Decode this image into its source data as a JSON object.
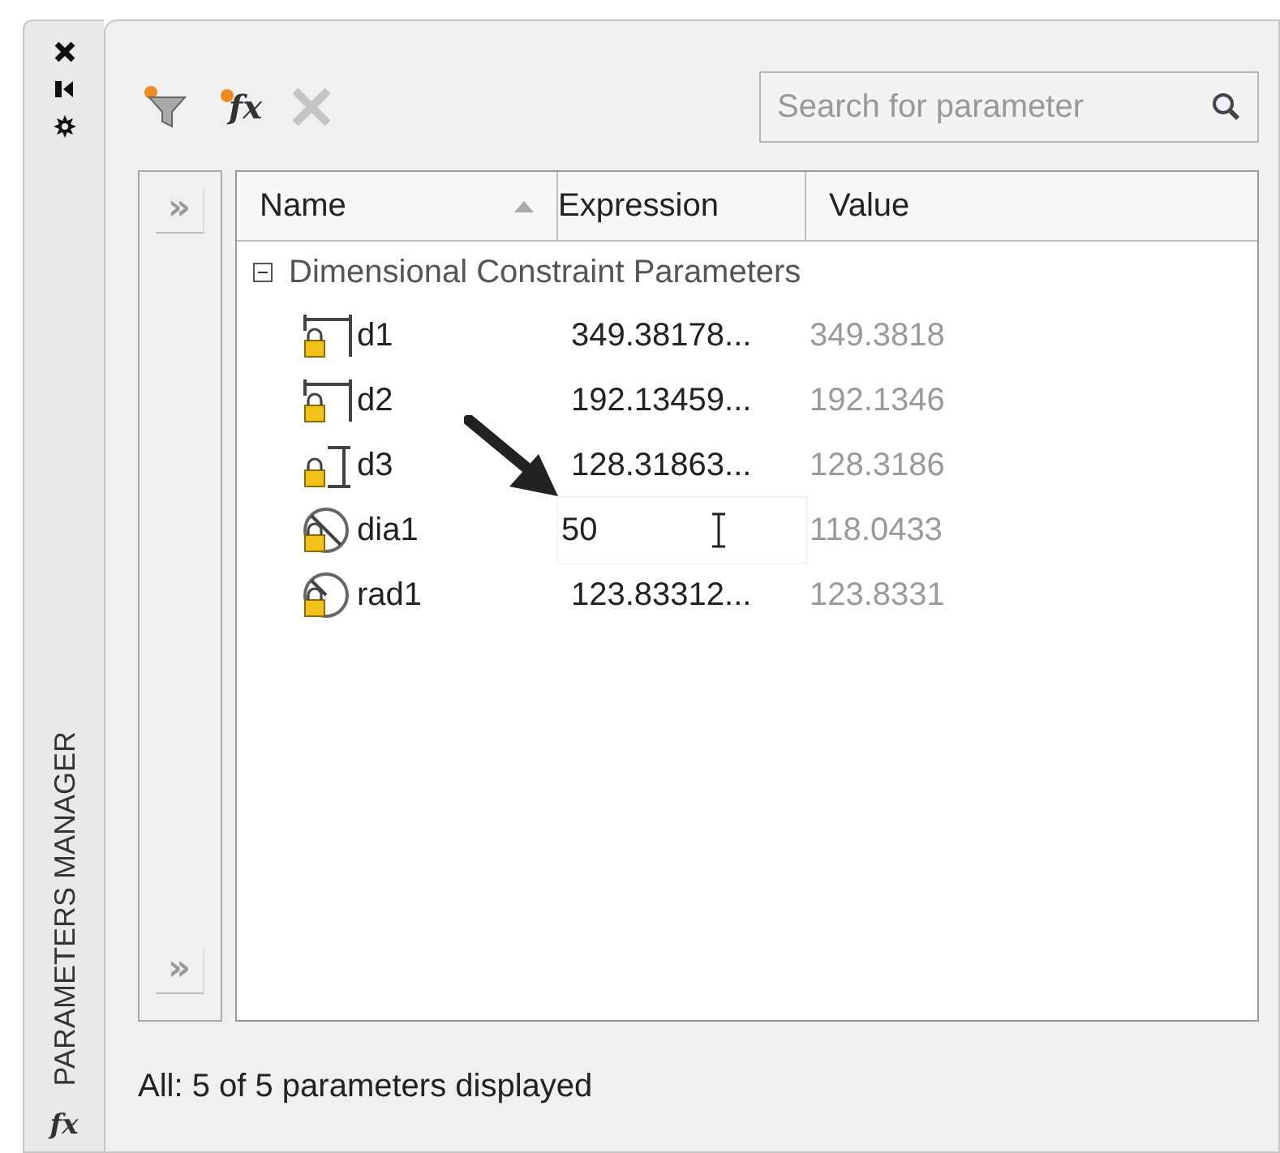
{
  "palette": {
    "title": "PARAMETERS MANAGER",
    "title_icon": "fx"
  },
  "toolbar": {
    "function_label": "fx",
    "delete_disabled": true
  },
  "search": {
    "placeholder": "Search for parameter"
  },
  "filter_pane": {
    "buttons": [
      "»",
      "»"
    ]
  },
  "table": {
    "columns": [
      {
        "label": "Name",
        "sorted": true
      },
      {
        "label": "Expression",
        "sorted": false
      },
      {
        "label": "Value",
        "sorted": false
      }
    ],
    "groups": [
      {
        "label": "Dimensional Constraint Parameters",
        "expanded": true,
        "rows": [
          {
            "kind": "horizontal",
            "name": "d1",
            "expression": "349.38178...",
            "value": "349.3818",
            "editing": false
          },
          {
            "kind": "horizontal",
            "name": "d2",
            "expression": "192.13459...",
            "value": "192.1346",
            "editing": false
          },
          {
            "kind": "vertical",
            "name": "d3",
            "expression": "128.31863...",
            "value": "128.3186",
            "editing": false
          },
          {
            "kind": "diameter",
            "name": "dia1",
            "expression": "50",
            "value": "118.0433",
            "editing": true
          },
          {
            "kind": "radius",
            "name": "rad1",
            "expression": "123.83312...",
            "value": "123.8331",
            "editing": false
          }
        ]
      }
    ]
  },
  "status_bar": "All: 5 of 5 parameters displayed"
}
